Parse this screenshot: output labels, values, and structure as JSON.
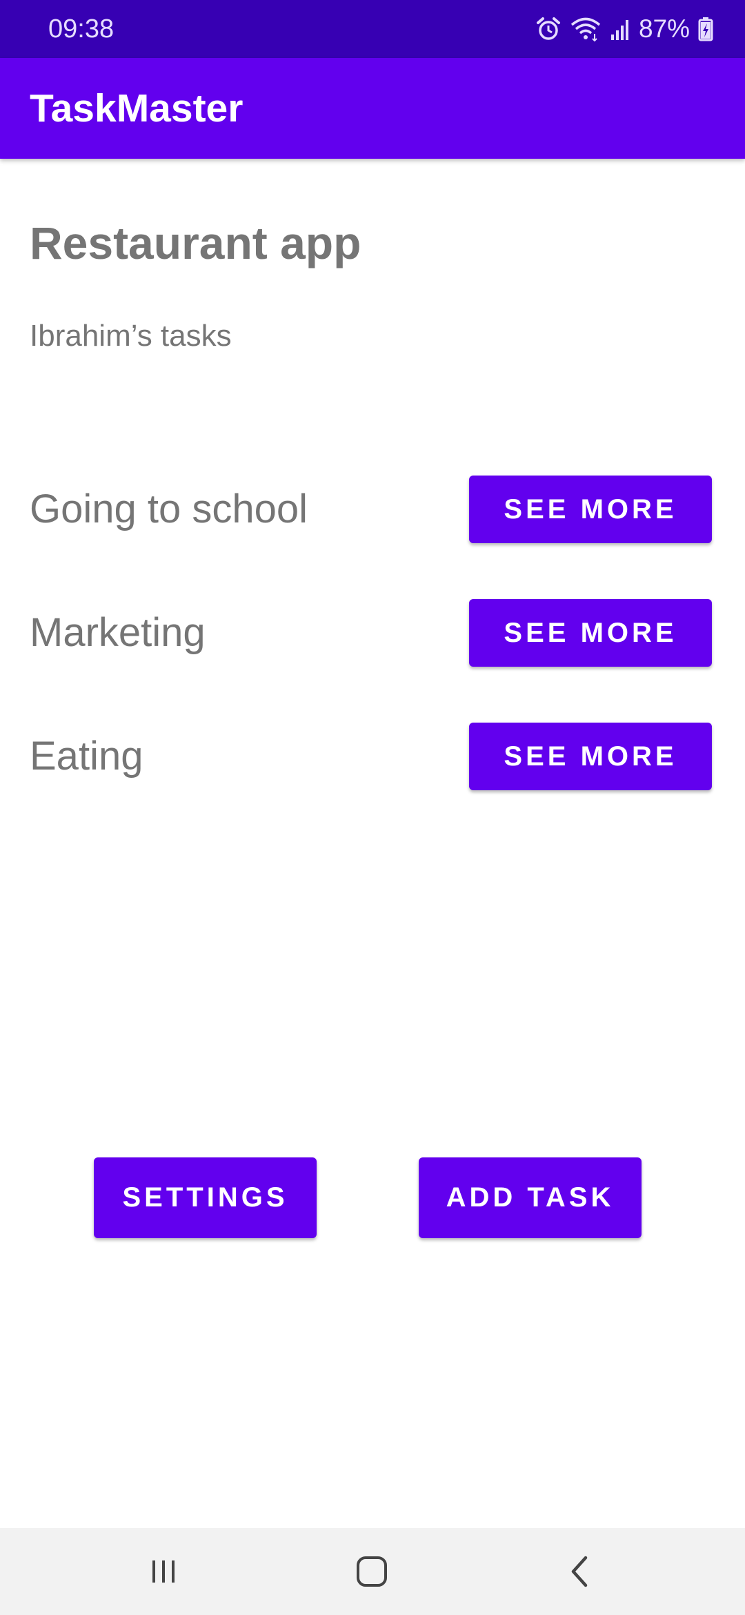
{
  "status_bar": {
    "time": "09:38",
    "battery_percent": "87%",
    "icons": [
      "alarm-icon",
      "wifi-icon",
      "signal-icon",
      "battery-charging-icon"
    ]
  },
  "app_bar": {
    "title": "TaskMaster"
  },
  "main": {
    "project_title": "Restaurant app",
    "owner_label": "Ibrahim’s tasks",
    "tasks": [
      {
        "title": "Going to school",
        "button_label": "SEE MORE"
      },
      {
        "title": "Marketing",
        "button_label": "SEE MORE"
      },
      {
        "title": "Eating",
        "button_label": "SEE MORE"
      }
    ],
    "settings_label": "SETTINGS",
    "add_task_label": "ADD TASK"
  },
  "nav_bar": {
    "buttons": [
      "recent-apps-icon",
      "home-icon",
      "back-icon"
    ]
  },
  "colors": {
    "status_bar": "#3700b3",
    "primary": "#6200ee",
    "text_secondary": "#757575",
    "nav_bar": "#f2f2f2"
  }
}
